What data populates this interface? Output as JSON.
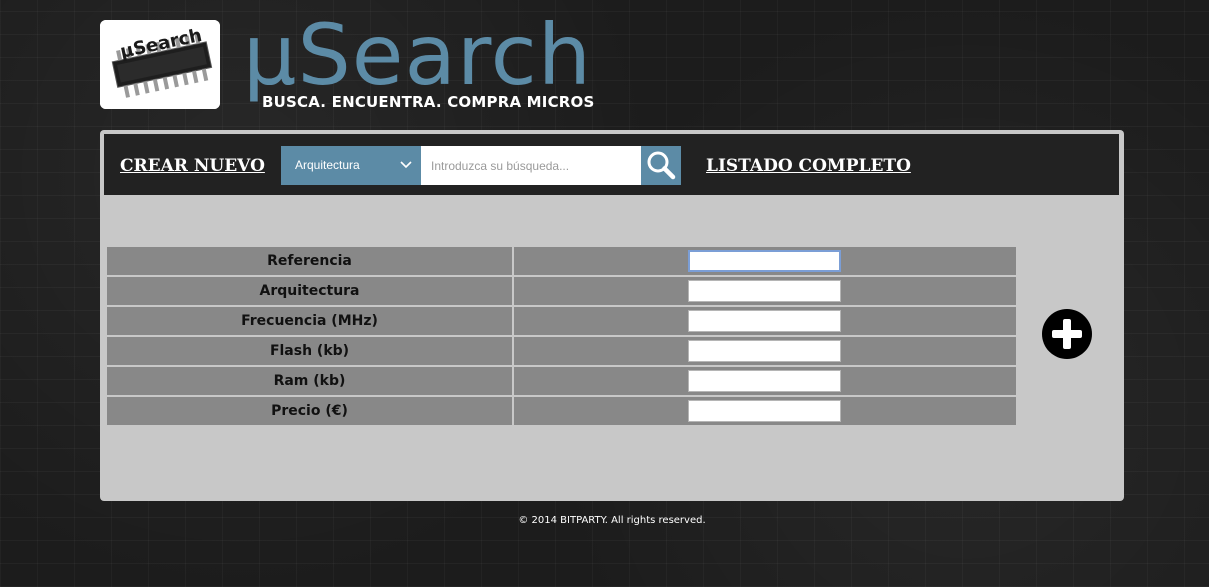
{
  "brand": {
    "logo_text": "µSearch",
    "title": "µSearch",
    "tagline": "BUSCA. ENCUENTRA. COMPRA MICROS",
    "accent_color": "#5c8ba6"
  },
  "nav": {
    "create_label": "CREAR NUEVO",
    "list_label": "LISTADO COMPLETO",
    "search": {
      "category_selected": "Arquitectura",
      "placeholder": "Introduzca su búsqueda...",
      "value": "",
      "button_icon": "search-icon"
    }
  },
  "form": {
    "fields": [
      {
        "label": "Referencia",
        "value": ""
      },
      {
        "label": "Arquitectura",
        "value": ""
      },
      {
        "label": "Frecuencia (MHz)",
        "value": ""
      },
      {
        "label": "Flash (kb)",
        "value": ""
      },
      {
        "label": "Ram (kb)",
        "value": ""
      },
      {
        "label": "Precio (€)",
        "value": ""
      }
    ],
    "add_icon": "plus-circle-icon"
  },
  "footer": {
    "text": "© 2014 BITPARTY. All rights reserved."
  }
}
